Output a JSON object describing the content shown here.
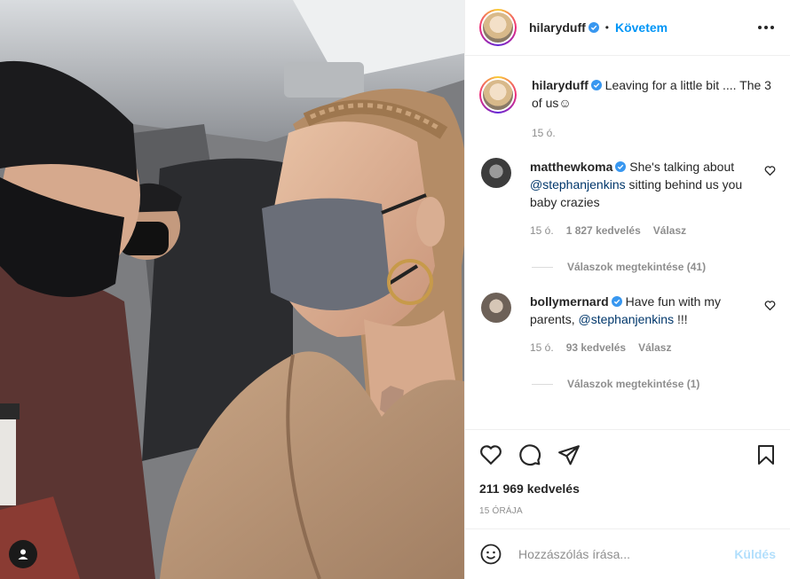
{
  "post": {
    "author": "hilaryduff",
    "follow_label": "Követem",
    "separator": "•",
    "caption": {
      "username": "hilaryduff",
      "text": "Leaving for a little bit .... The 3 of us☺",
      "time": "15 ó."
    }
  },
  "comments": [
    {
      "username": "matthewkoma",
      "text_before": "She's talking about ",
      "mention": "@stephanjenkins",
      "text_after": " sitting behind us you baby crazies",
      "time": "15 ó.",
      "likes": "1 827 kedvelés",
      "reply_label": "Válasz",
      "view_replies": "Válaszok megtekintése (41)"
    },
    {
      "username": "bollymernard",
      "text_before": "Have fun with my parents, ",
      "mention": "@stephanjenkins",
      "text_after": " !!!",
      "time": "15 ó.",
      "likes": "93 kedvelés",
      "reply_label": "Válasz",
      "view_replies": "Válaszok megtekintése (1)"
    }
  ],
  "stats": {
    "likes": "211 969 kedvelés",
    "date": "15 ÓRÁJA"
  },
  "add_comment": {
    "placeholder": "Hozzászólás írása...",
    "send_label": "Küldés"
  },
  "colors": {
    "link": "#0095f6",
    "mention": "#00376b",
    "muted": "#8e8e8e",
    "verified": "#3897f0"
  }
}
